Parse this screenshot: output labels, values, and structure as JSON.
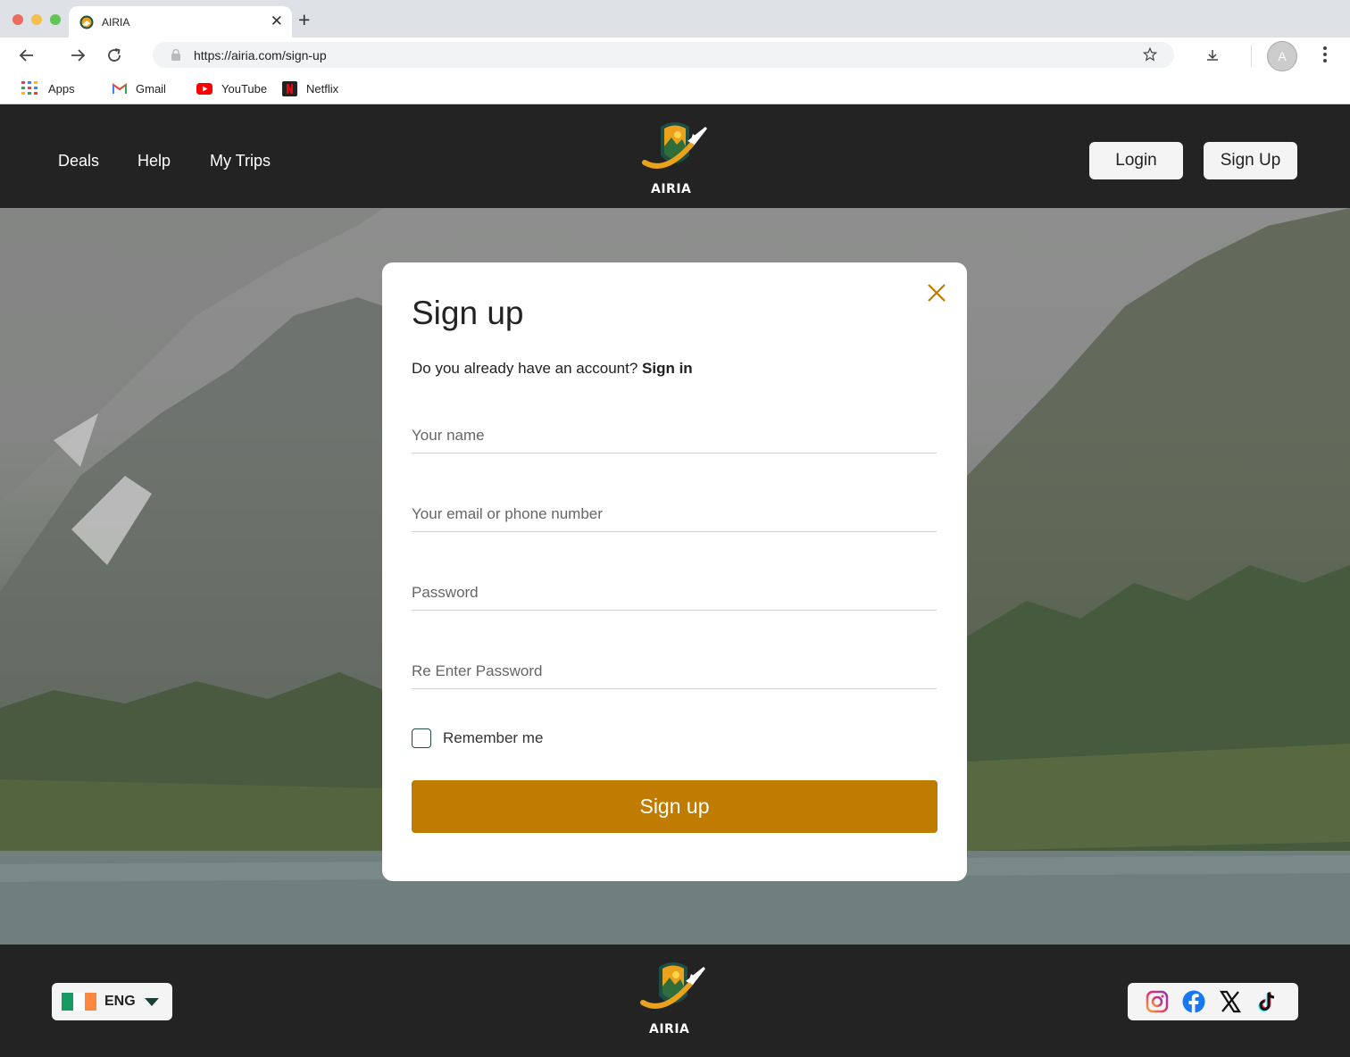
{
  "browser": {
    "tab_title": "AIRIA",
    "url": "https://airia.com/sign-up",
    "avatar_letter": "A",
    "bookmarks": [
      {
        "label": "Apps",
        "icon": "apps-grid-icon"
      },
      {
        "label": "Gmail",
        "icon": "gmail-icon"
      },
      {
        "label": "YouTube",
        "icon": "youtube-icon"
      },
      {
        "label": "Netflix",
        "icon": "netflix-icon"
      }
    ]
  },
  "header": {
    "nav": [
      "Deals",
      "Help",
      "My Trips"
    ],
    "brand": "AIRIA",
    "login_label": "Login",
    "signup_label": "Sign Up"
  },
  "modal": {
    "title": "Sign up",
    "subtitle_text": "Do you already have an account?",
    "signin_link": "Sign in",
    "fields": {
      "name_placeholder": "Your name",
      "email_placeholder": "Your email or phone number",
      "password_placeholder": "Password",
      "repassword_placeholder": "Re Enter Password"
    },
    "remember_label": "Remember me",
    "submit_label": "Sign up"
  },
  "footer": {
    "language": "ENG",
    "brand": "AIRIA",
    "social": [
      "instagram-icon",
      "facebook-icon",
      "x-icon",
      "tiktok-icon"
    ]
  },
  "colors": {
    "accent": "#bf7c00",
    "header_bg": "#232323",
    "checkbox_border": "#1d4e46"
  }
}
